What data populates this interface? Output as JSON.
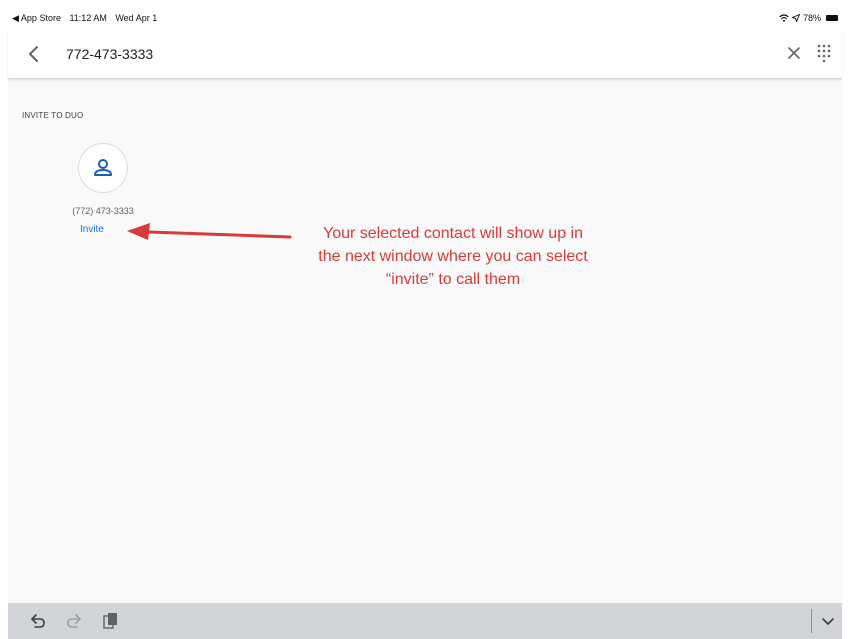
{
  "status_bar": {
    "back_app": "◀ App Store",
    "time": "11:12 AM",
    "date": "Wed Apr 1",
    "battery": "78%"
  },
  "header": {
    "search_value": "772-473-3333",
    "back_icon": "chevron-left-icon",
    "clear_icon": "close-icon",
    "dialpad_icon": "dialpad-icon"
  },
  "content": {
    "section_label": "INVITE TO DUO",
    "contact": {
      "number": "(772) 473-3333",
      "invite_label": "Invite",
      "avatar_icon": "person-icon"
    }
  },
  "annotation": {
    "lines": [
      "Your selected contact will show up in",
      "the next window where you can select",
      "“invite” to call them"
    ]
  },
  "colors": {
    "accent": "#1a73e8",
    "annotation": "#d93a3a",
    "toolbar": "#d2d4d8"
  }
}
